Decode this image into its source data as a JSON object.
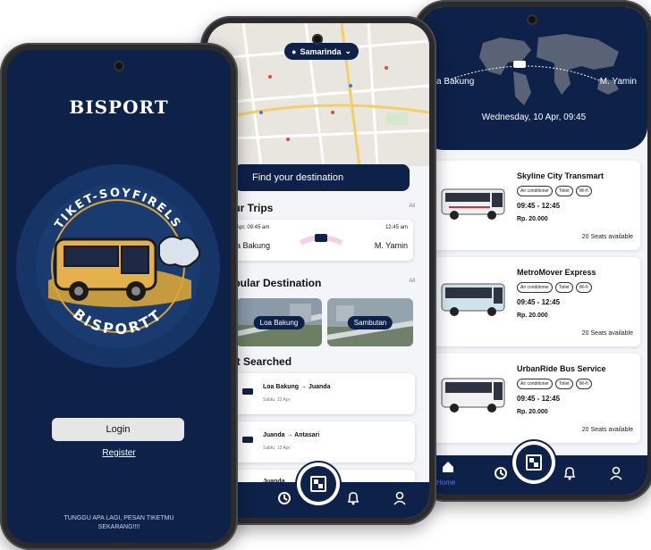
{
  "phone_login": {
    "title": "BISPORT",
    "logo": {
      "arc_top": "TIKET-SOYFIRELS",
      "arc_bottom": "BISPORTT"
    },
    "login_label": "Login",
    "register_label": "Register",
    "tagline_line1": "TUNGGU APA LAGI, PESAN TIKETMU",
    "tagline_line2": "SEKARANG!!!!"
  },
  "phone_home": {
    "city": "Samarinda",
    "find_destination": "Find your destination",
    "your_trips": {
      "title": "our Trips",
      "all": "All",
      "trip": {
        "depart": "Apr, 09:45 am",
        "arrive": "12:45 am",
        "from": "a Bakung",
        "to": "M. Yamin"
      }
    },
    "popular": {
      "title": "opular Destination",
      "all": "All",
      "items": [
        "Loa Bakung",
        "Sambutan"
      ]
    },
    "last_searched": {
      "title": "st Searched",
      "items": [
        {
          "from": "Loa Bakung",
          "arrow": "→",
          "to": "Juanda",
          "date": "Sabtu, 13 Apr"
        },
        {
          "from": "Juanda",
          "arrow": "→",
          "to": "Antasari",
          "date": "Sabtu, 13 Apr"
        },
        {
          "from": "Juanda",
          "arrow": "",
          "to": "",
          "date": ""
        }
      ]
    },
    "nav_partial_label": "me"
  },
  "phone_results": {
    "from": "a Bakung",
    "to": "M. Yamin",
    "date": "Wednesday, 10 Apr, 09:45",
    "buses": [
      {
        "name": "Skyline City Transmart",
        "amenities": [
          "Air conditioner",
          "Toilet",
          "Wi-fi"
        ],
        "time": "09:45 - 12:45",
        "price": "Rp. 20.000",
        "seats": "20 Seats available",
        "color": "#e9eef3"
      },
      {
        "name": "MetroMover Express",
        "amenities": [
          "Air conditioner",
          "Toilet",
          "Wi-fi"
        ],
        "time": "09:45 - 12:45",
        "price": "Rp. 20.000",
        "seats": "20 Seats available",
        "color": "#cfe3ea"
      },
      {
        "name": "UrbanRide Bus Service",
        "amenities": [
          "Air conditioner",
          "Toilet",
          "Wi-fi"
        ],
        "time": "09:45 - 12:45",
        "price": "Rp. 20.000",
        "seats": "20 Seats available",
        "color": "#f2f2f2"
      }
    ],
    "nav_home_label": "Home"
  },
  "colors": {
    "navy": "#0e2148",
    "gold": "#d9a53a"
  },
  "icons": [
    "location-pin-icon",
    "chevron-down-icon",
    "bus-icon",
    "home-icon",
    "history-icon",
    "qr-code-icon",
    "notification-icon",
    "profile-icon"
  ]
}
